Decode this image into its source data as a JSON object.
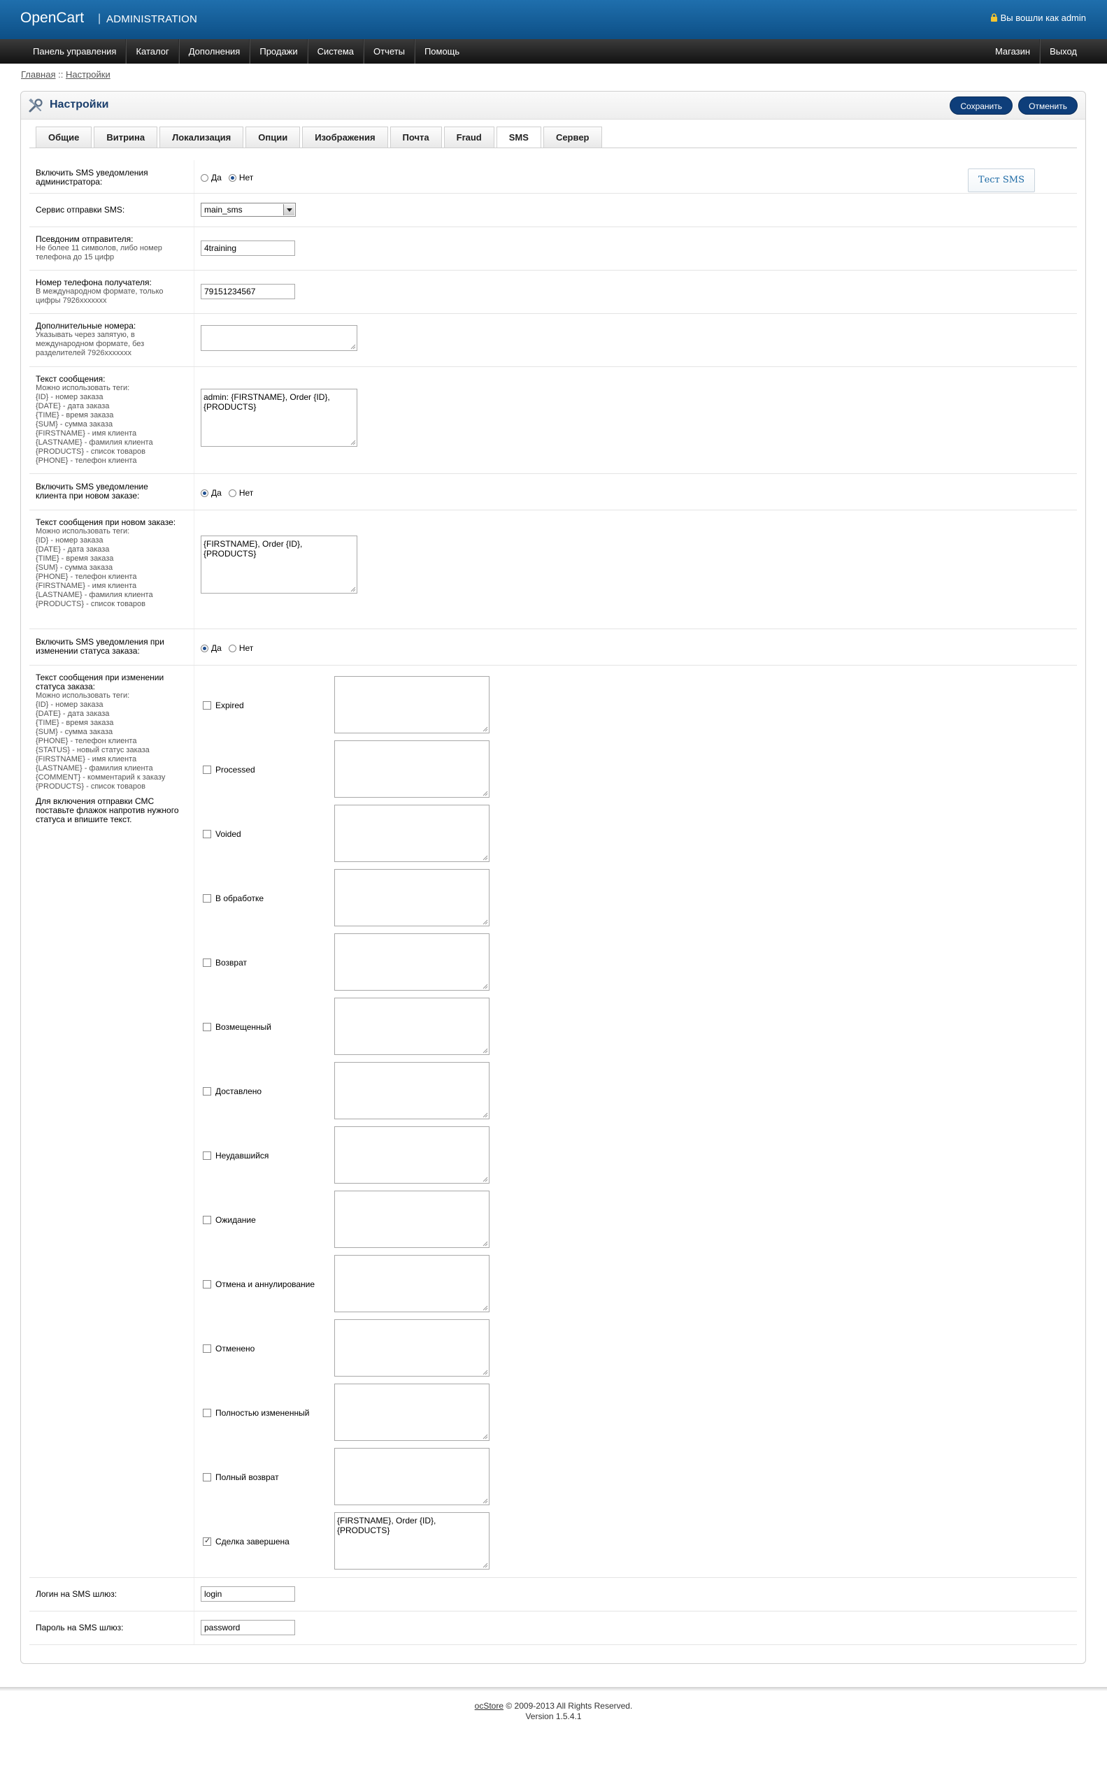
{
  "header": {
    "logo": "OpenCart",
    "separator": "|",
    "subtitle": "ADMINISTRATION",
    "logged_in": "Вы вошли как admin"
  },
  "menu": {
    "left": [
      "Панель управления",
      "Каталог",
      "Дополнения",
      "Продажи",
      "Система",
      "Отчеты",
      "Помощь"
    ],
    "right": [
      "Магазин",
      "Выход"
    ]
  },
  "breadcrumb": {
    "home": "Главная",
    "separator": "::",
    "current": "Настройки"
  },
  "page": {
    "title": "Настройки",
    "save_label": "Сохранить",
    "cancel_label": "Отменить"
  },
  "tabs": [
    "Общие",
    "Витрина",
    "Локализация",
    "Опции",
    "Изображения",
    "Почта",
    "Fraud",
    "SMS",
    "Сервер"
  ],
  "active_tab": "SMS",
  "form": {
    "test_sms_label": "Тест SMS",
    "admin_notify": {
      "label": "Включить SMS уведомления администратора:",
      "yes": "Да",
      "no": "Нет",
      "selected": "Нет"
    },
    "service": {
      "label": "Сервис отправки SMS:",
      "value": "main_sms"
    },
    "sender": {
      "label": "Псевдоним отправителя:",
      "help": "Не более 11 символов, либо номер телефона до 15 цифр",
      "value": "4training"
    },
    "recipient": {
      "label": "Номер телефона получателя:",
      "help": "В международном формате, только цифры 7926xxxxxxx",
      "value": "79151234567"
    },
    "extra_numbers": {
      "label": "Дополнительные номера:",
      "help": "Указывать через запятую, в международном формате, без разделителей 7926xxxxxxx",
      "value": ""
    },
    "message_text": {
      "label": "Текст сообщения:",
      "help": [
        "Можно использовать теги:",
        "{ID} - номер заказа",
        "{DATE} - дата заказа",
        "{TIME} - время заказа",
        "{SUM} - сумма заказа",
        "{FIRSTNAME} - имя клиента",
        "{LASTNAME} - фамилия клиента",
        "{PRODUCTS} - список товаров",
        "{PHONE} - телефон клиента"
      ],
      "value": "admin: {FIRSTNAME}, Order {ID}, {PRODUCTS}"
    },
    "client_notify": {
      "label": "Включить SMS уведомление клиента при новом заказе:",
      "yes": "Да",
      "no": "Нет",
      "selected": "Да"
    },
    "new_order_text": {
      "label": "Текст сообщения при новом заказе:",
      "help": [
        "Можно использовать теги:",
        "{ID} - номер заказа",
        "{DATE} - дата заказа",
        "{TIME} - время заказа",
        "{SUM} - сумма заказа",
        "{PHONE} - телефон клиента",
        "{FIRSTNAME} - имя клиента",
        "{LASTNAME} - фамилия клиента",
        "{PRODUCTS} - список товаров"
      ],
      "value": "{FIRSTNAME}, Order {ID}, {PRODUCTS}"
    },
    "status_notify": {
      "label": "Включить SMS уведомления при изменении статуса заказа:",
      "yes": "Да",
      "no": "Нет",
      "selected": "Да"
    },
    "status_text": {
      "label": "Текст сообщения при изменении статуса заказа:",
      "help": [
        "Можно использовать теги:",
        "{ID} - номер заказа",
        "{DATE} - дата заказа",
        "{TIME} - время заказа",
        "{SUM} - сумма заказа",
        "{PHONE} - телефон клиента",
        "{STATUS} - новый статус заказа",
        "{FIRSTNAME} - имя клиента",
        "{LASTNAME} - фамилия клиента",
        "{COMMENT} - комментарий к заказу",
        "{PRODUCTS} - список товаров"
      ],
      "note": "Для включения отправки СМС поставьте флажок напротив нужного статуса и впишите текст.",
      "statuses": [
        {
          "name": "Expired",
          "checked": false,
          "text": ""
        },
        {
          "name": "Processed",
          "checked": false,
          "text": ""
        },
        {
          "name": "Voided",
          "checked": false,
          "text": ""
        },
        {
          "name": "В обработке",
          "checked": false,
          "text": ""
        },
        {
          "name": "Возврат",
          "checked": false,
          "text": ""
        },
        {
          "name": "Возмещенный",
          "checked": false,
          "text": ""
        },
        {
          "name": "Доставлено",
          "checked": false,
          "text": ""
        },
        {
          "name": "Неудавшийся",
          "checked": false,
          "text": ""
        },
        {
          "name": "Ожидание",
          "checked": false,
          "text": ""
        },
        {
          "name": "Отмена и аннулирование",
          "checked": false,
          "text": ""
        },
        {
          "name": "Отменено",
          "checked": false,
          "text": ""
        },
        {
          "name": "Полностью измененный",
          "checked": false,
          "text": ""
        },
        {
          "name": "Полный возврат",
          "checked": false,
          "text": ""
        },
        {
          "name": "Сделка завершена",
          "checked": true,
          "text": "{FIRSTNAME}, Order {ID}, {PRODUCTS}"
        }
      ]
    },
    "gateway_login": {
      "label": "Логин на SMS шлюз:",
      "value": "login"
    },
    "gateway_password": {
      "label": "Пароль на SMS шлюз:",
      "value": "password"
    }
  },
  "footer": {
    "link": "ocStore",
    "copyright": "© 2009-2013 All Rights Reserved.",
    "version": "Version 1.5.4.1"
  },
  "colors": {
    "header_blue": "#0d4f86",
    "menu_dark": "#111111",
    "button_blue": "#0e3e7a",
    "title_blue": "#1a3e6c"
  }
}
